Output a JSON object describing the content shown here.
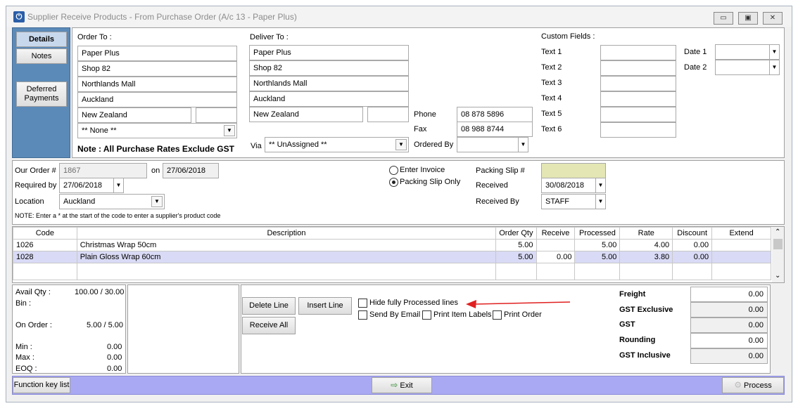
{
  "window": {
    "title": "Supplier Receive Products - From Purchase Order (A/c 13 - Paper Plus)"
  },
  "side_tabs": [
    "Details",
    "Notes",
    "Deferred Payments"
  ],
  "order_to": {
    "label": "Order To  :",
    "lines": [
      "Paper Plus",
      "Shop 82",
      "Northlands Mall",
      "Auckland",
      "New Zealand"
    ],
    "extra": "",
    "combo": "** None **",
    "note": "Note : All Purchase Rates Exclude GST"
  },
  "deliver_to": {
    "label": "Deliver To :",
    "lines": [
      "Paper Plus",
      "Shop 82",
      "Northlands Mall",
      "Auckland",
      "New Zealand"
    ],
    "extra": "",
    "via_label": "Via",
    "via": "** UnAssigned **"
  },
  "contact": {
    "phone_label": "Phone",
    "phone": "08 878 5896",
    "fax_label": "Fax",
    "fax": "08 988 8744",
    "ordered_by_label": "Ordered By",
    "ordered_by": ""
  },
  "custom_fields": {
    "label": "Custom Fields  :",
    "texts": [
      "Text 1",
      "Text 2",
      "Text 3",
      "Text 4",
      "Text 5",
      "Text 6"
    ],
    "date1_label": "Date 1",
    "date2_label": "Date 2"
  },
  "order": {
    "our_order_label": "Our Order #",
    "our_order": "1867",
    "on_label": "on",
    "on_date": "27/06/2018",
    "required_by_label": "Required by",
    "required_by": "27/06/2018",
    "location_label": "Location",
    "location": "Auckland",
    "note": "NOTE: Enter a * at the start of the code to enter a supplier's product code",
    "enter_invoice": "Enter Invoice",
    "packing_slip_only": "Packing Slip Only",
    "packing_slip_label": "Packing Slip #",
    "packing_slip": "",
    "received_label": "Received",
    "received": "30/08/2018",
    "received_by_label": "Received By",
    "received_by": "STAFF"
  },
  "grid": {
    "headers": [
      "Code",
      "Description",
      "Order Qty",
      "Receive",
      "Processed",
      "Rate",
      "Discount",
      "Extend"
    ],
    "rows": [
      [
        "1026",
        "Christmas Wrap 50cm",
        "5.00",
        "",
        "5.00",
        "4.00",
        "0.00",
        ""
      ],
      [
        "1028",
        "Plain Gloss Wrap 60cm",
        "5.00",
        "0.00",
        "5.00",
        "3.80",
        "0.00",
        ""
      ]
    ]
  },
  "stock": {
    "avail_label": "Avail Qty :",
    "avail": "100.00 / 30.00",
    "bin_label": "Bin :",
    "bin": "",
    "on_order_label": "On Order :",
    "on_order": "5.00 / 5.00",
    "min_label": "Min :",
    "min": "0.00",
    "max_label": "Max :",
    "max": "0.00",
    "eoq_label": "EOQ :",
    "eoq": "0.00"
  },
  "actions": {
    "delete_line": "Delete Line",
    "insert_line": "Insert Line",
    "receive_all": "Receive All",
    "hide_processed": "Hide fully Processed lines",
    "send_by_email": "Send By Email",
    "print_labels": "Print Item Labels",
    "print_order": "Print Order"
  },
  "totals": {
    "freight_label": "Freight",
    "freight": "0.00",
    "gst_excl_label": "GST Exclusive",
    "gst_excl": "0.00",
    "gst_label": "GST",
    "gst": "0.00",
    "rounding_label": "Rounding",
    "rounding": "0.00",
    "gst_incl_label": "GST Inclusive",
    "gst_incl": "0.00"
  },
  "footer": {
    "function_keys": "Function key list",
    "exit": "Exit",
    "process": "Process"
  },
  "colors": {
    "side_panel": "#5b8ab8",
    "footer_bar": "#a9a9f3",
    "selected_row": "#d9daf5",
    "arrow": "#e02020"
  }
}
